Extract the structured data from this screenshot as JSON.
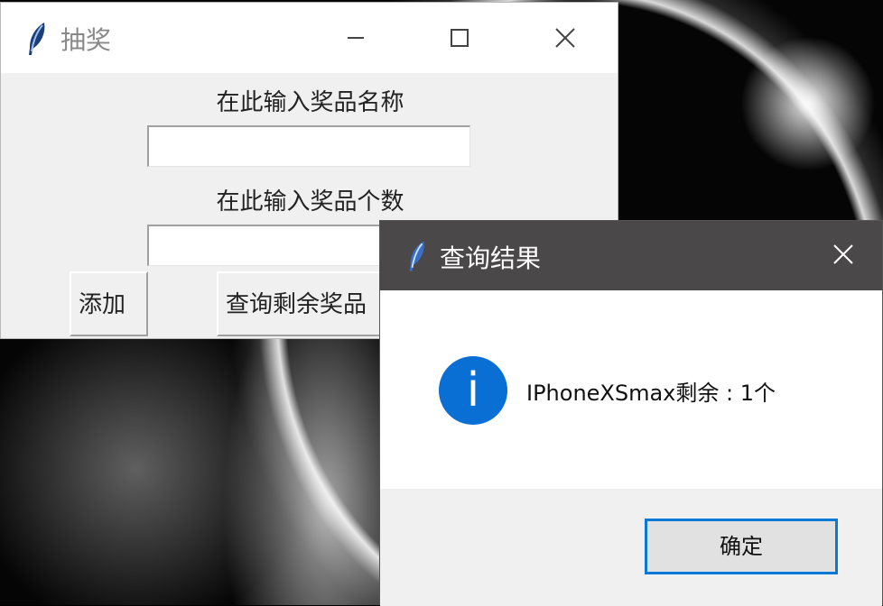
{
  "main_window": {
    "title": "抽奖",
    "prize_name_label": "在此输入奖品名称",
    "prize_name_value": "",
    "prize_count_label": "在此输入奖品个数",
    "prize_count_value": "",
    "add_button": "添加",
    "query_button": "查询剩余奖品"
  },
  "dialog": {
    "title": "查询结果",
    "message": "IPhoneXSmax剩余 : 1个",
    "icon": "info-icon",
    "ok_button": "确定"
  },
  "colors": {
    "dialog_titlebar": "#4a4848",
    "info_icon": "#0a6fd4",
    "focus_border": "#0a78d7"
  }
}
